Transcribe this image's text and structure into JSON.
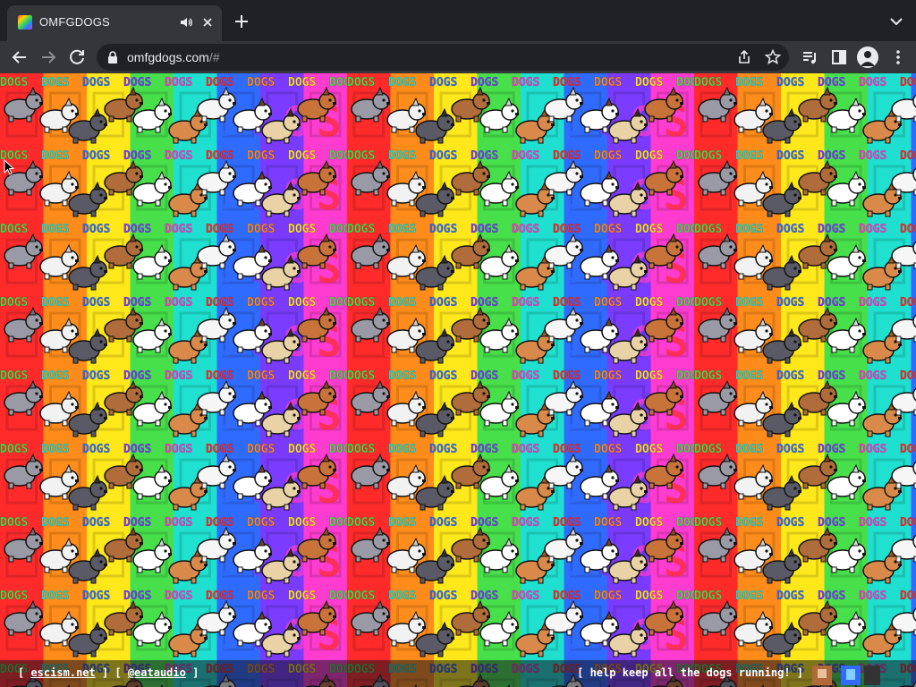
{
  "tab": {
    "title": "OMFGDOGS",
    "favicon": "rainbow-dog-favicon",
    "audio_icon": "speaker-icon",
    "close_icon": "close-icon"
  },
  "toolbar": {
    "url_host": "omfgdogs.com",
    "url_path": "/#",
    "icons": [
      "back-arrow-icon",
      "forward-arrow-icon",
      "reload-icon",
      "lock-icon",
      "share-icon",
      "star-icon",
      "media-queue-icon",
      "side-panel-icon",
      "profile-avatar-icon",
      "kebab-menu-icon"
    ]
  },
  "page": {
    "banner_word": "DOGS",
    "rainbow_colors": [
      "#ff2a2a",
      "#ff8c1a",
      "#ffe81a",
      "#47e04a",
      "#1fe0d0",
      "#2f6bff",
      "#7a3bff",
      "#ff3bd0"
    ],
    "dogs": [
      {
        "name": "grey-fluffy-dog",
        "body": "#9a9aa6",
        "ear": "#6e6e78"
      },
      {
        "name": "white-poodle",
        "body": "#f2f2f2",
        "ear": "#cfcfcf"
      },
      {
        "name": "husky",
        "body": "#5a5a66",
        "ear": "#2d2d33"
      },
      {
        "name": "brown-dog",
        "body": "#b06c3a",
        "ear": "#7a4420"
      },
      {
        "name": "white-samoyed",
        "body": "#ffffff",
        "ear": "#d9d9d9"
      },
      {
        "name": "corgi",
        "body": "#d98a4a",
        "ear": "#a85a22"
      },
      {
        "name": "westie",
        "body": "#f6f6f6",
        "ear": "#d0d0d0"
      },
      {
        "name": "beagle",
        "body": "#ffffff",
        "ear": "#7a3e1a"
      },
      {
        "name": "pug",
        "body": "#e9d2a6",
        "ear": "#3a2a1a"
      },
      {
        "name": "shiba",
        "body": "#c8733a",
        "ear": "#8a4a1e"
      }
    ]
  },
  "footer": {
    "open_bracket": "[ ",
    "link1": "escism.net",
    "between": " ] [ ",
    "link2": "@eataudio",
    "close_bracket": " ]",
    "right_text": "[ help keep all the dogs running! ]"
  }
}
